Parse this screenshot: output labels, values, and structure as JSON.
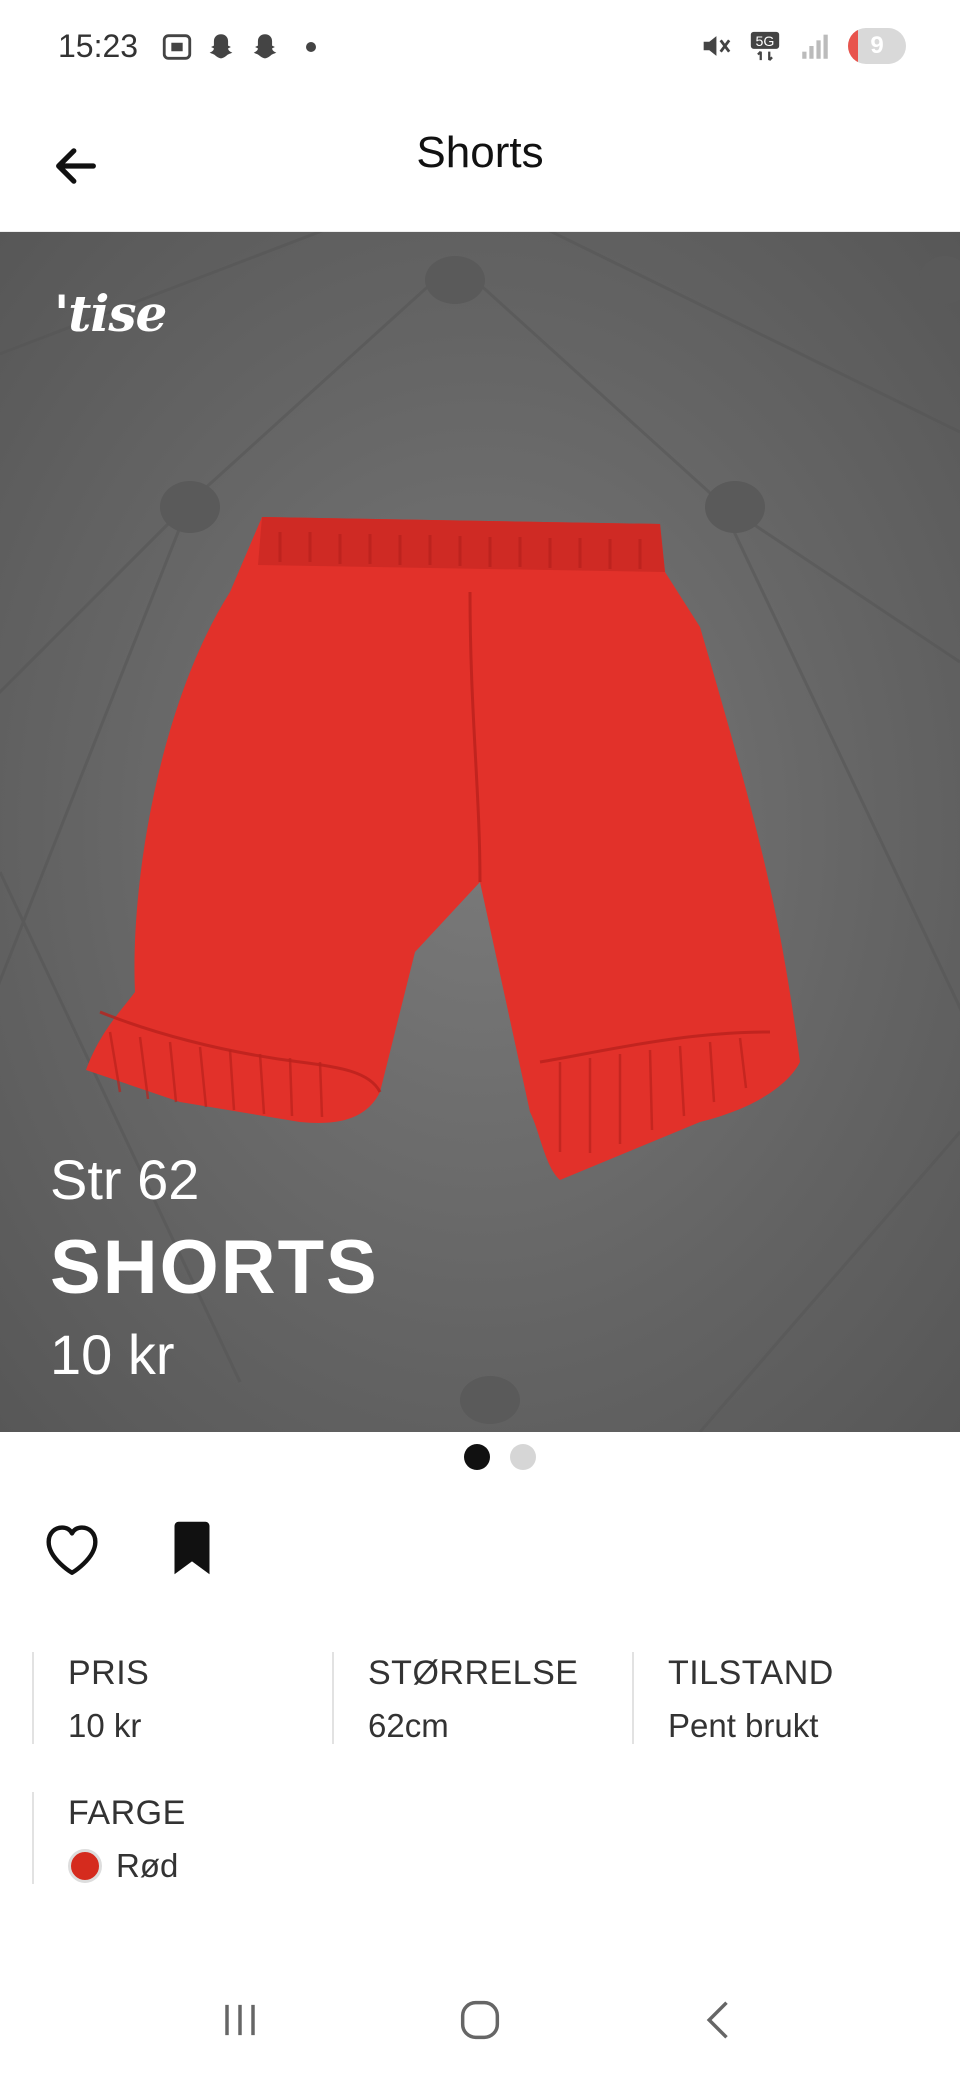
{
  "status_bar": {
    "time": "15:23",
    "battery_level": "9",
    "network_label": "5G"
  },
  "app_bar": {
    "title": "Shorts",
    "back_icon": "arrow-left-icon"
  },
  "hero": {
    "brand": "'tise",
    "overlay_size": "Str 62",
    "overlay_title": "SHORTS",
    "overlay_price": "10 kr",
    "page_count": 2,
    "active_page": 1
  },
  "actions": {
    "like_icon": "heart-icon",
    "save_icon": "bookmark-icon"
  },
  "details": [
    {
      "label": "PRIS",
      "value": "10 kr"
    },
    {
      "label": "STØRRELSE",
      "value": "62cm"
    },
    {
      "label": "TILSTAND",
      "value": "Pent brukt"
    },
    {
      "label": "FARGE",
      "value": "Rød",
      "swatch_color": "#d52b1e"
    }
  ],
  "nav_bar": {
    "recents_icon": "recents-icon",
    "home_icon": "home-icon",
    "back_icon": "back-chevron-icon"
  }
}
